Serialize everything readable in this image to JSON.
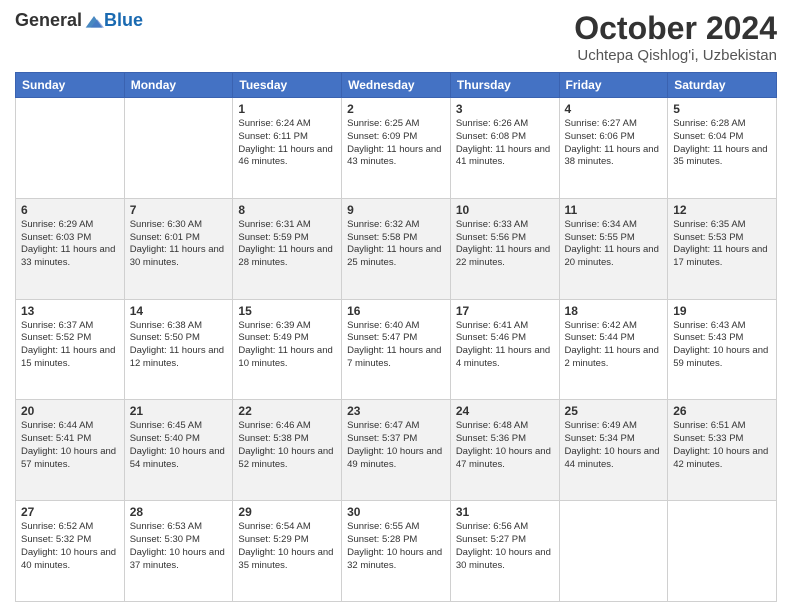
{
  "header": {
    "logo": {
      "general": "General",
      "blue": "Blue",
      "tagline": ""
    },
    "title": "October 2024",
    "location": "Uchtepa Qishlog'i, Uzbekistan"
  },
  "days_of_week": [
    "Sunday",
    "Monday",
    "Tuesday",
    "Wednesday",
    "Thursday",
    "Friday",
    "Saturday"
  ],
  "weeks": [
    [
      {
        "day": "",
        "sunrise": "",
        "sunset": "",
        "daylight": ""
      },
      {
        "day": "",
        "sunrise": "",
        "sunset": "",
        "daylight": ""
      },
      {
        "day": "1",
        "sunrise": "Sunrise: 6:24 AM",
        "sunset": "Sunset: 6:11 PM",
        "daylight": "Daylight: 11 hours and 46 minutes."
      },
      {
        "day": "2",
        "sunrise": "Sunrise: 6:25 AM",
        "sunset": "Sunset: 6:09 PM",
        "daylight": "Daylight: 11 hours and 43 minutes."
      },
      {
        "day": "3",
        "sunrise": "Sunrise: 6:26 AM",
        "sunset": "Sunset: 6:08 PM",
        "daylight": "Daylight: 11 hours and 41 minutes."
      },
      {
        "day": "4",
        "sunrise": "Sunrise: 6:27 AM",
        "sunset": "Sunset: 6:06 PM",
        "daylight": "Daylight: 11 hours and 38 minutes."
      },
      {
        "day": "5",
        "sunrise": "Sunrise: 6:28 AM",
        "sunset": "Sunset: 6:04 PM",
        "daylight": "Daylight: 11 hours and 35 minutes."
      }
    ],
    [
      {
        "day": "6",
        "sunrise": "Sunrise: 6:29 AM",
        "sunset": "Sunset: 6:03 PM",
        "daylight": "Daylight: 11 hours and 33 minutes."
      },
      {
        "day": "7",
        "sunrise": "Sunrise: 6:30 AM",
        "sunset": "Sunset: 6:01 PM",
        "daylight": "Daylight: 11 hours and 30 minutes."
      },
      {
        "day": "8",
        "sunrise": "Sunrise: 6:31 AM",
        "sunset": "Sunset: 5:59 PM",
        "daylight": "Daylight: 11 hours and 28 minutes."
      },
      {
        "day": "9",
        "sunrise": "Sunrise: 6:32 AM",
        "sunset": "Sunset: 5:58 PM",
        "daylight": "Daylight: 11 hours and 25 minutes."
      },
      {
        "day": "10",
        "sunrise": "Sunrise: 6:33 AM",
        "sunset": "Sunset: 5:56 PM",
        "daylight": "Daylight: 11 hours and 22 minutes."
      },
      {
        "day": "11",
        "sunrise": "Sunrise: 6:34 AM",
        "sunset": "Sunset: 5:55 PM",
        "daylight": "Daylight: 11 hours and 20 minutes."
      },
      {
        "day": "12",
        "sunrise": "Sunrise: 6:35 AM",
        "sunset": "Sunset: 5:53 PM",
        "daylight": "Daylight: 11 hours and 17 minutes."
      }
    ],
    [
      {
        "day": "13",
        "sunrise": "Sunrise: 6:37 AM",
        "sunset": "Sunset: 5:52 PM",
        "daylight": "Daylight: 11 hours and 15 minutes."
      },
      {
        "day": "14",
        "sunrise": "Sunrise: 6:38 AM",
        "sunset": "Sunset: 5:50 PM",
        "daylight": "Daylight: 11 hours and 12 minutes."
      },
      {
        "day": "15",
        "sunrise": "Sunrise: 6:39 AM",
        "sunset": "Sunset: 5:49 PM",
        "daylight": "Daylight: 11 hours and 10 minutes."
      },
      {
        "day": "16",
        "sunrise": "Sunrise: 6:40 AM",
        "sunset": "Sunset: 5:47 PM",
        "daylight": "Daylight: 11 hours and 7 minutes."
      },
      {
        "day": "17",
        "sunrise": "Sunrise: 6:41 AM",
        "sunset": "Sunset: 5:46 PM",
        "daylight": "Daylight: 11 hours and 4 minutes."
      },
      {
        "day": "18",
        "sunrise": "Sunrise: 6:42 AM",
        "sunset": "Sunset: 5:44 PM",
        "daylight": "Daylight: 11 hours and 2 minutes."
      },
      {
        "day": "19",
        "sunrise": "Sunrise: 6:43 AM",
        "sunset": "Sunset: 5:43 PM",
        "daylight": "Daylight: 10 hours and 59 minutes."
      }
    ],
    [
      {
        "day": "20",
        "sunrise": "Sunrise: 6:44 AM",
        "sunset": "Sunset: 5:41 PM",
        "daylight": "Daylight: 10 hours and 57 minutes."
      },
      {
        "day": "21",
        "sunrise": "Sunrise: 6:45 AM",
        "sunset": "Sunset: 5:40 PM",
        "daylight": "Daylight: 10 hours and 54 minutes."
      },
      {
        "day": "22",
        "sunrise": "Sunrise: 6:46 AM",
        "sunset": "Sunset: 5:38 PM",
        "daylight": "Daylight: 10 hours and 52 minutes."
      },
      {
        "day": "23",
        "sunrise": "Sunrise: 6:47 AM",
        "sunset": "Sunset: 5:37 PM",
        "daylight": "Daylight: 10 hours and 49 minutes."
      },
      {
        "day": "24",
        "sunrise": "Sunrise: 6:48 AM",
        "sunset": "Sunset: 5:36 PM",
        "daylight": "Daylight: 10 hours and 47 minutes."
      },
      {
        "day": "25",
        "sunrise": "Sunrise: 6:49 AM",
        "sunset": "Sunset: 5:34 PM",
        "daylight": "Daylight: 10 hours and 44 minutes."
      },
      {
        "day": "26",
        "sunrise": "Sunrise: 6:51 AM",
        "sunset": "Sunset: 5:33 PM",
        "daylight": "Daylight: 10 hours and 42 minutes."
      }
    ],
    [
      {
        "day": "27",
        "sunrise": "Sunrise: 6:52 AM",
        "sunset": "Sunset: 5:32 PM",
        "daylight": "Daylight: 10 hours and 40 minutes."
      },
      {
        "day": "28",
        "sunrise": "Sunrise: 6:53 AM",
        "sunset": "Sunset: 5:30 PM",
        "daylight": "Daylight: 10 hours and 37 minutes."
      },
      {
        "day": "29",
        "sunrise": "Sunrise: 6:54 AM",
        "sunset": "Sunset: 5:29 PM",
        "daylight": "Daylight: 10 hours and 35 minutes."
      },
      {
        "day": "30",
        "sunrise": "Sunrise: 6:55 AM",
        "sunset": "Sunset: 5:28 PM",
        "daylight": "Daylight: 10 hours and 32 minutes."
      },
      {
        "day": "31",
        "sunrise": "Sunrise: 6:56 AM",
        "sunset": "Sunset: 5:27 PM",
        "daylight": "Daylight: 10 hours and 30 minutes."
      },
      {
        "day": "",
        "sunrise": "",
        "sunset": "",
        "daylight": ""
      },
      {
        "day": "",
        "sunrise": "",
        "sunset": "",
        "daylight": ""
      }
    ]
  ]
}
